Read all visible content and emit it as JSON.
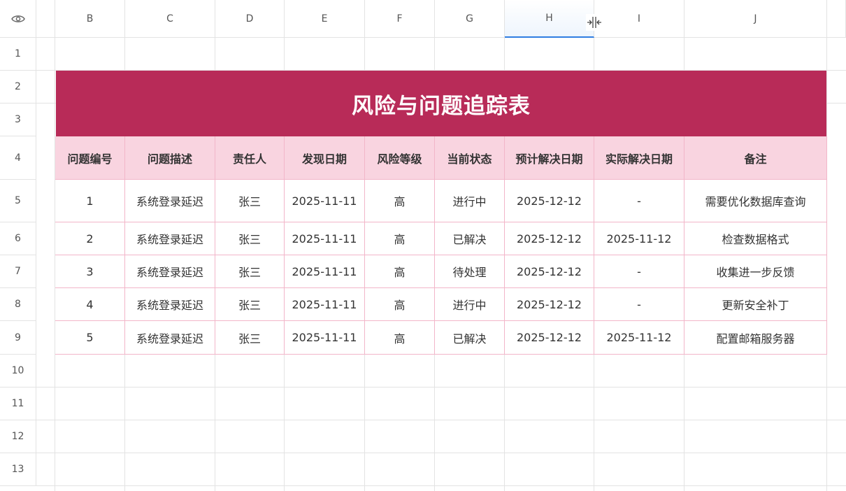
{
  "columns": [
    "B",
    "C",
    "D",
    "E",
    "F",
    "G",
    "H",
    "I",
    "J"
  ],
  "rows": [
    "1",
    "2",
    "3",
    "4",
    "5",
    "6",
    "7",
    "8",
    "9",
    "10",
    "11",
    "12",
    "13"
  ],
  "selected_column": "H",
  "title": "风险与问题追踪表",
  "table": {
    "headers": [
      "问题编号",
      "问题描述",
      "责任人",
      "发现日期",
      "风险等级",
      "当前状态",
      "预计解决日期",
      "实际解决日期",
      "备注"
    ],
    "rows": [
      [
        "1",
        "系统登录延迟",
        "张三",
        "2025-11-11",
        "高",
        "进行中",
        "2025-12-12",
        "-",
        "需要优化数据库查询"
      ],
      [
        "2",
        "系统登录延迟",
        "张三",
        "2025-11-11",
        "高",
        "已解决",
        "2025-12-12",
        "2025-11-12",
        "检查数据格式"
      ],
      [
        "3",
        "系统登录延迟",
        "张三",
        "2025-11-11",
        "高",
        "待处理",
        "2025-12-12",
        "-",
        "收集进一步反馈"
      ],
      [
        "4",
        "系统登录延迟",
        "张三",
        "2025-11-11",
        "高",
        "进行中",
        "2025-12-12",
        "-",
        "更新安全补丁"
      ],
      [
        "5",
        "系统登录延迟",
        "张三",
        "2025-11-11",
        "高",
        "已解决",
        "2025-12-12",
        "2025-11-12",
        "配置邮箱服务器"
      ]
    ]
  },
  "colors": {
    "title_bg": "#b82b58",
    "header_bg": "#f9d4e0",
    "border": "#f2b6c9",
    "selection": "#2f7de1"
  },
  "icons": {
    "corner": "eye-icon",
    "cursor": "column-resize-cursor-icon"
  }
}
